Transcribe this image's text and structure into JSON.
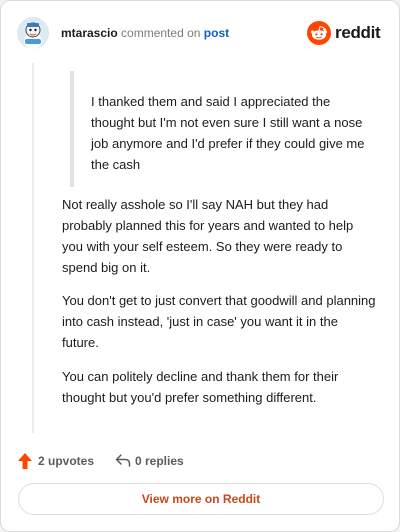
{
  "header": {
    "username": "mtarascio",
    "commented_text": "commented on",
    "post_link": "post",
    "brand": "reddit"
  },
  "comment": {
    "quote": "I thanked them and said I appreciated the thought but I'm not even sure I still want a nose job anymore and I'd prefer if they could give me the cash",
    "paragraphs": [
      "Not really asshole so I'll say NAH but they had probably planned this for years and wanted to help you with your self esteem. So they were ready to spend big on it.",
      "You don't get to just convert that goodwill and planning into cash instead, 'just in case' you want it in the future.",
      "You can politely decline and thank them for their thought but you'd prefer something different."
    ]
  },
  "actions": {
    "upvotes": "2 upvotes",
    "replies": "0 replies"
  },
  "footer": {
    "view_more": "View more on Reddit"
  },
  "colors": {
    "brand_orange": "#ff4500",
    "upvote": "#ff4500",
    "link_blue": "#0a63c7",
    "view_more_text": "#c54a1b"
  },
  "icons": {
    "avatar": "user-avatar",
    "logo": "reddit-logo-icon",
    "upvote": "upvote-arrow-icon",
    "reply": "reply-arrow-icon"
  }
}
